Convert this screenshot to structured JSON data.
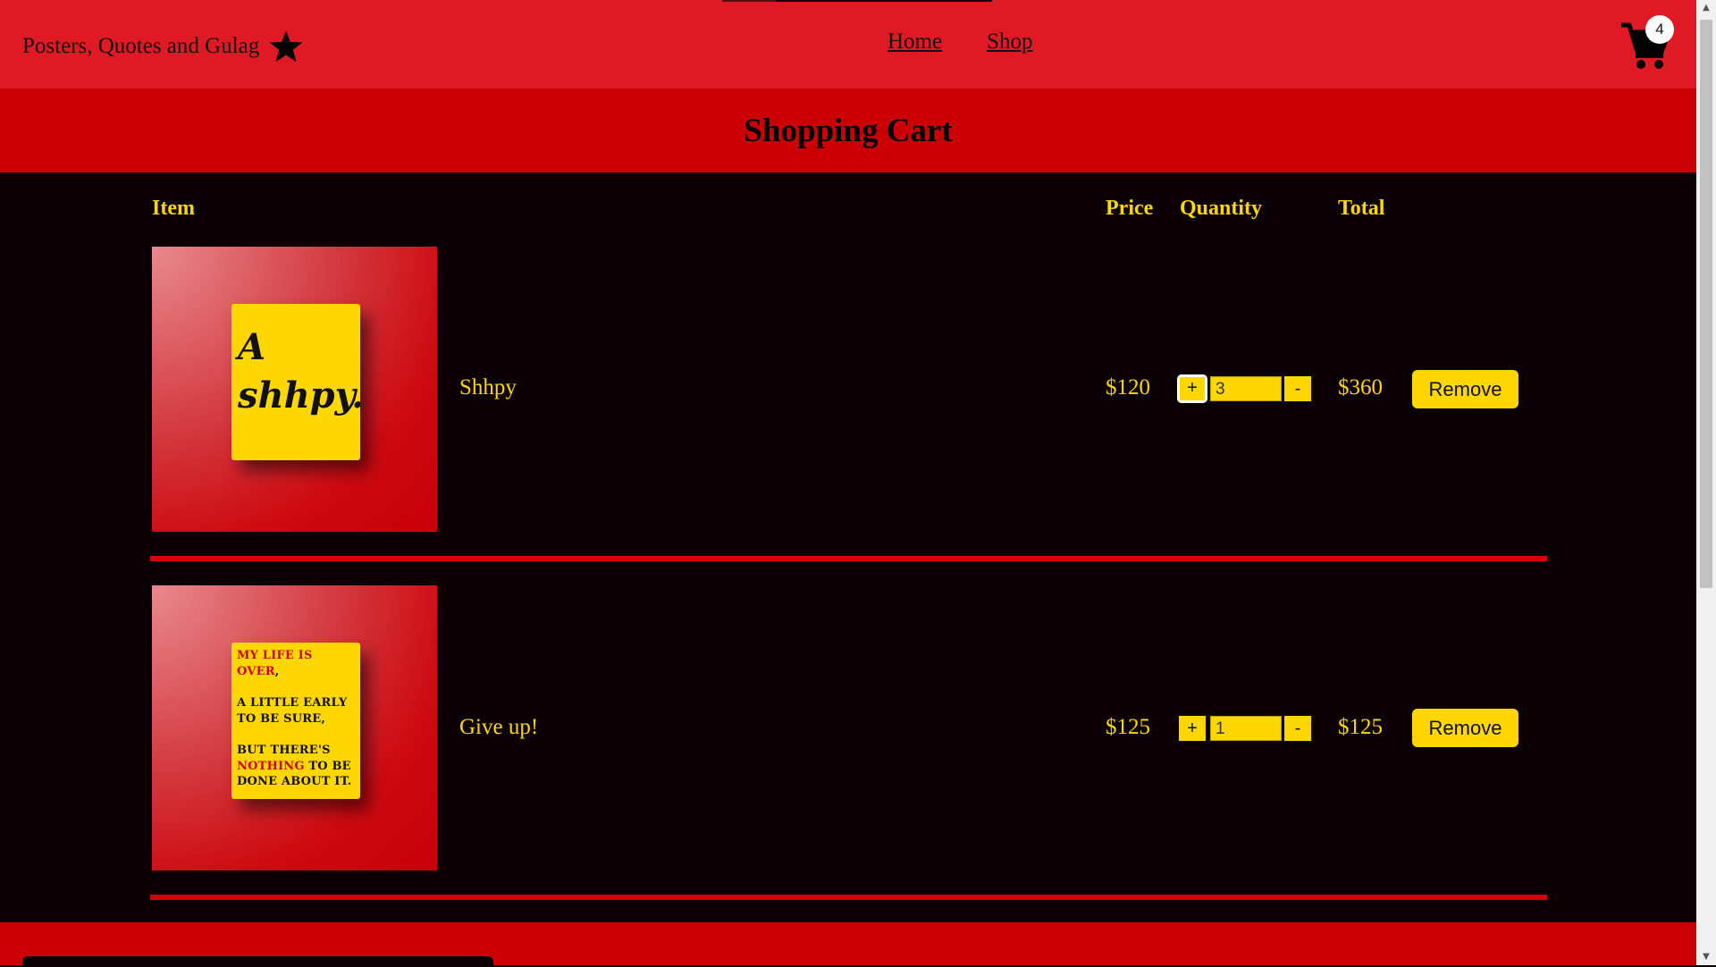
{
  "navbar": {
    "brand": "Posters, Quotes and Gulag",
    "links": [
      "Home",
      "Shop"
    ],
    "cart_count": "4"
  },
  "page_title": "Shopping Cart",
  "columns": {
    "item": "Item",
    "price": "Price",
    "quantity": "Quantity",
    "total": "Total"
  },
  "cart_items": [
    {
      "name": "Shhpy",
      "price": "$120",
      "quantity": "3",
      "total": "$360",
      "poster_text": [
        "A",
        "shhpy."
      ]
    },
    {
      "name": "Give up!",
      "price": "$125",
      "quantity": "1",
      "total": "$125",
      "poster_lines": {
        "p1a": "MY LIFE IS",
        "p1b": "OVER",
        "p1c": ",",
        "p2": "A LITTLE EARLY TO BE SURE,",
        "p3a": "BUT THERE'S",
        "p3b": "NOTHING",
        "p3c": " TO BE DONE ABOUT IT."
      }
    }
  ],
  "buttons": {
    "plus": "+",
    "minus": "-",
    "remove": "Remove"
  },
  "colors": {
    "navbar": "#df1a24",
    "title_band": "#cb0005",
    "background": "#0b0003",
    "accent": "#ffd700"
  }
}
